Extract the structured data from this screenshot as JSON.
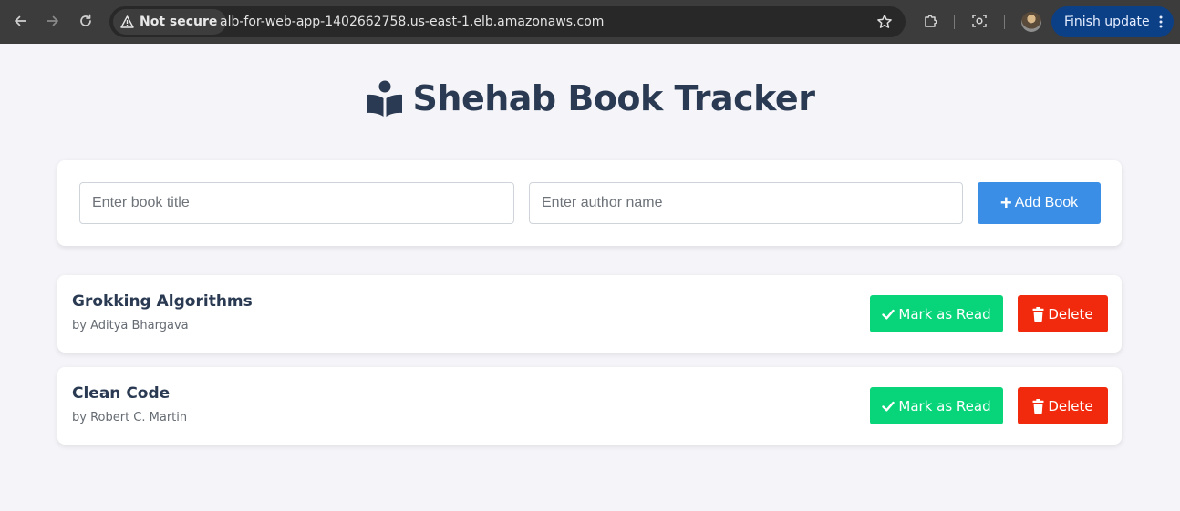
{
  "browser": {
    "security_label": "Not secure",
    "url": "alb-for-web-app-1402662758.us-east-1.elb.amazonaws.com",
    "finish_update_label": "Finish update",
    "icons": [
      "back-arrow-icon",
      "forward-arrow-icon",
      "reload-icon",
      "warning-triangle-icon",
      "star-icon",
      "extensions-icon",
      "screenshot-icon",
      "profile-avatar",
      "more-vert-icon"
    ]
  },
  "page": {
    "title": "Shehab Book Tracker",
    "title_icon": "book-reader-icon"
  },
  "form": {
    "title_placeholder": "Enter book title",
    "author_placeholder": "Enter author name",
    "title_value": "",
    "author_value": "",
    "add_button_label": "Add Book",
    "add_button_icon": "plus-icon"
  },
  "books": [
    {
      "title": "Grokking Algorithms",
      "author": "by Aditya Bhargava",
      "read_label": "Mark as Read",
      "delete_label": "Delete"
    },
    {
      "title": "Clean Code",
      "author": "by Robert C. Martin",
      "read_label": "Mark as Read",
      "delete_label": "Delete"
    }
  ],
  "colors": {
    "primary": "#3a8ee6",
    "success": "#08d47a",
    "danger": "#f12a0e",
    "heading": "#2a3a52",
    "background": "#f5f5f9"
  }
}
